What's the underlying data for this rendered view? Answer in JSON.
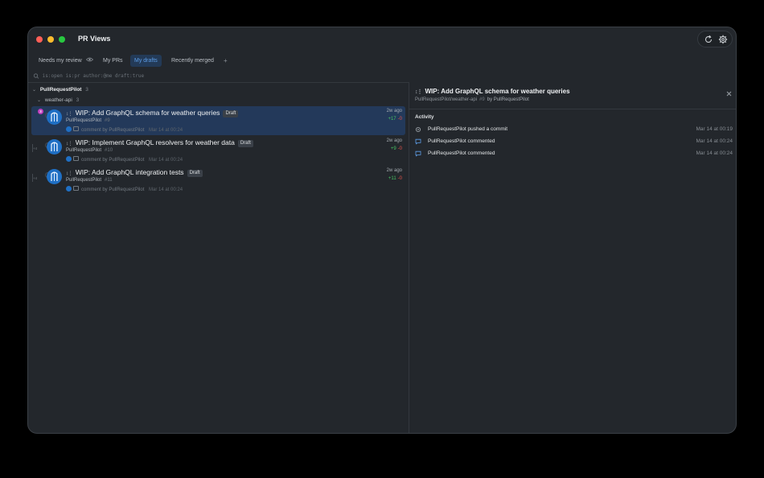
{
  "app": {
    "title": "PR Views"
  },
  "tabs": [
    {
      "label": "Needs my review",
      "has_eye": true
    },
    {
      "label": "My PRs"
    },
    {
      "label": "My drafts",
      "active": true
    },
    {
      "label": "Recently merged"
    }
  ],
  "add_tab_label": "+",
  "filter": {
    "query": "is:open is:pr author:@me draft:true"
  },
  "group": {
    "org": "PullRequestPilot",
    "org_count": "3",
    "repo": "weather-api",
    "repo_count": "3"
  },
  "prs": [
    {
      "title": "WIP: Add GraphQL schema for weather queries",
      "draft_label": "Draft",
      "author": "PullRequestPilot",
      "number": "#9",
      "comment": "comment by PullRequestPilot",
      "comment_time": "Mar 14 at 00:24",
      "age": "2w ago",
      "additions": "+17",
      "deletions": "-0",
      "badge": "3",
      "side_mark": ""
    },
    {
      "title": "WIP: Implement GraphQL resolvers for weather data",
      "draft_label": "Draft",
      "author": "PullRequestPilot",
      "number": "#10",
      "comment": "comment by PullRequestPilot",
      "comment_time": "Mar 14 at 00:24",
      "age": "2w ago",
      "additions": "+9",
      "deletions": "-0",
      "badge": "",
      "side_mark": "+4"
    },
    {
      "title": "WIP: Add GraphQL integration tests",
      "draft_label": "Draft",
      "author": "PullRequestPilot",
      "number": "#11",
      "comment": "comment by PullRequestPilot",
      "comment_time": "Mar 14 at 00:24",
      "age": "2w ago",
      "additions": "+11",
      "deletions": "-0",
      "badge": "",
      "side_mark": "+4"
    }
  ],
  "detail": {
    "title": "WIP: Add GraphQL schema for weather queries",
    "repo": "PullRequestPilot/weather-api",
    "number": "#9",
    "by": "by PullRequestPilot",
    "activity_label": "Activity",
    "activity": [
      {
        "icon": "commit-icon",
        "text": "PullRequestPilot pushed a commit",
        "time": "Mar 14 at 00:19"
      },
      {
        "icon": "comment-icon",
        "text": "PullRequestPilot commented",
        "time": "Mar 14 at 00:24"
      },
      {
        "icon": "comment-icon",
        "text": "PullRequestPilot commented",
        "time": "Mar 14 at 00:24"
      }
    ]
  },
  "colors": {
    "accent": "#5d9ee8",
    "selected_row": "#23395a",
    "additions": "#48c063",
    "deletions": "#e5534b",
    "badge": "#c23fbf"
  }
}
